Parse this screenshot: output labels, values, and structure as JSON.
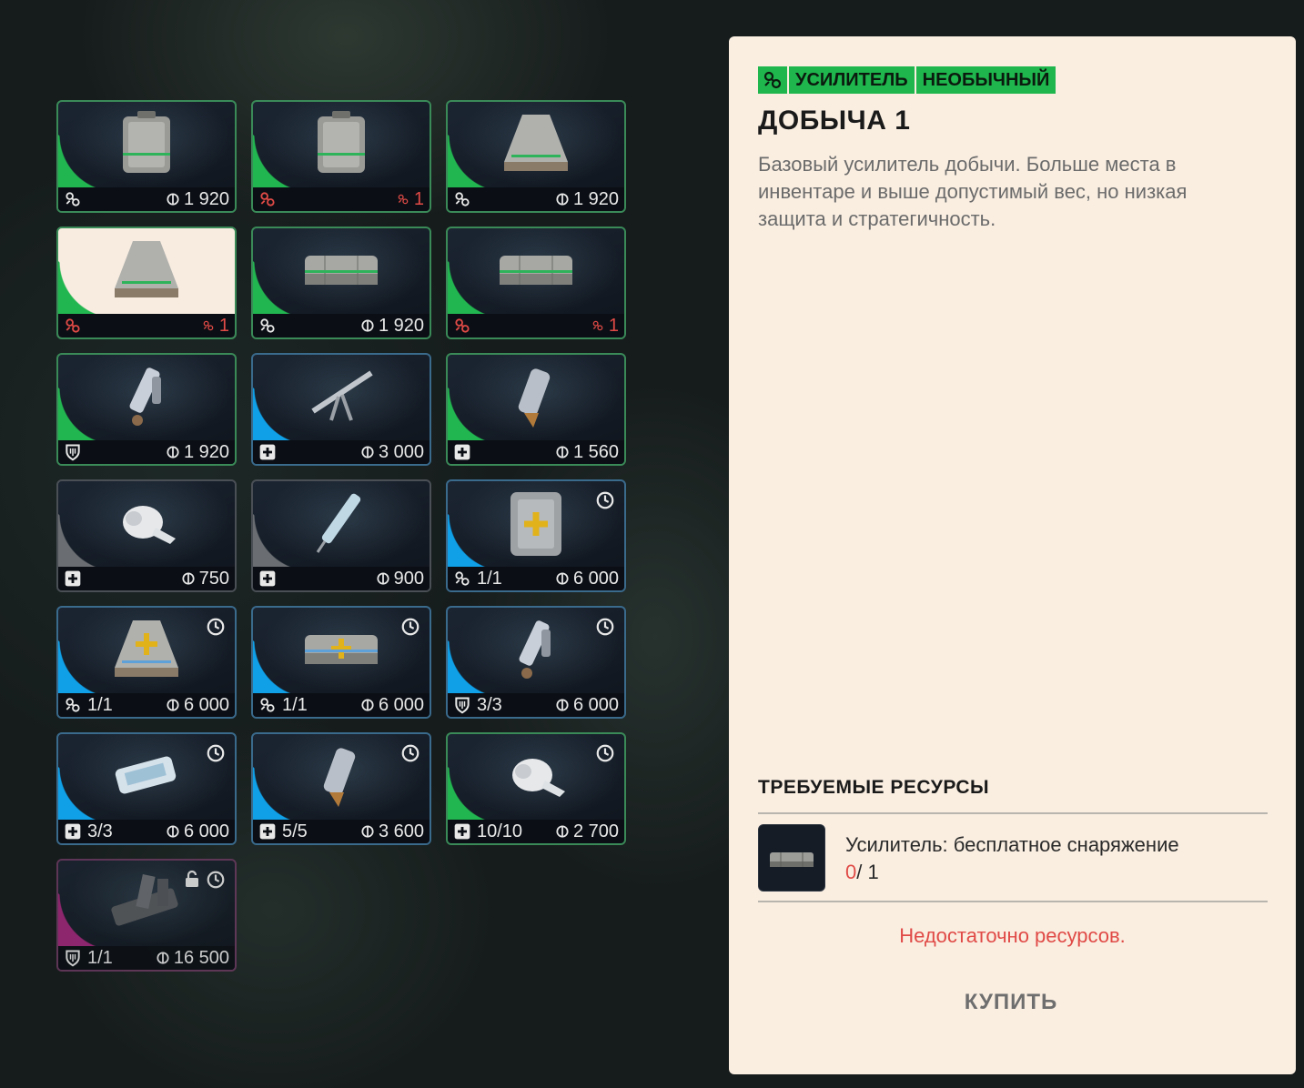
{
  "grid": {
    "items": [
      {
        "id": "c0",
        "rarity": "green",
        "thumb": "crate",
        "cat_icon": "augment-icon",
        "cat_red": false,
        "count": "",
        "price": "1 920",
        "price_red": false,
        "timer": false,
        "lock": false,
        "selected": false
      },
      {
        "id": "c1",
        "rarity": "green",
        "thumb": "crate",
        "cat_icon": "augment-icon",
        "cat_red": true,
        "count": "",
        "price": "1",
        "price_red": true,
        "timer": false,
        "lock": false,
        "selected": false
      },
      {
        "id": "c2",
        "rarity": "green",
        "thumb": "pyramid",
        "cat_icon": "augment-icon",
        "cat_red": false,
        "count": "",
        "price": "1 920",
        "price_red": false,
        "timer": false,
        "lock": false,
        "selected": false
      },
      {
        "id": "c3",
        "rarity": "green",
        "thumb": "pyramid",
        "cat_icon": "augment-icon",
        "cat_red": true,
        "count": "",
        "price": "1",
        "price_red": true,
        "timer": false,
        "lock": false,
        "selected": true
      },
      {
        "id": "c4",
        "rarity": "green",
        "thumb": "long",
        "cat_icon": "augment-icon",
        "cat_red": false,
        "count": "",
        "price": "1 920",
        "price_red": false,
        "timer": false,
        "lock": false,
        "selected": false
      },
      {
        "id": "c5",
        "rarity": "green",
        "thumb": "long",
        "cat_icon": "augment-icon",
        "cat_red": true,
        "count": "",
        "price": "1",
        "price_red": true,
        "timer": false,
        "lock": false,
        "selected": false
      },
      {
        "id": "c6",
        "rarity": "green",
        "thumb": "gadget",
        "cat_icon": "shield-icon",
        "cat_red": false,
        "count": "",
        "price": "1 920",
        "price_red": false,
        "timer": false,
        "lock": false,
        "selected": false
      },
      {
        "id": "c7",
        "rarity": "blue",
        "thumb": "tool",
        "cat_icon": "medkit-icon",
        "cat_red": false,
        "count": "",
        "price": "3 000",
        "price_red": false,
        "timer": false,
        "lock": false,
        "selected": false
      },
      {
        "id": "c8",
        "rarity": "green",
        "thumb": "vial",
        "cat_icon": "medkit-icon",
        "cat_red": false,
        "count": "",
        "price": "1 560",
        "price_red": false,
        "timer": false,
        "lock": false,
        "selected": false
      },
      {
        "id": "c9",
        "rarity": "gray",
        "thumb": "bandage",
        "cat_icon": "medkit-icon",
        "cat_red": false,
        "count": "",
        "price": "750",
        "price_red": false,
        "timer": false,
        "lock": false,
        "selected": false
      },
      {
        "id": "c10",
        "rarity": "gray",
        "thumb": "syringe",
        "cat_icon": "medkit-icon",
        "cat_red": false,
        "count": "",
        "price": "900",
        "price_red": false,
        "timer": false,
        "lock": false,
        "selected": false
      },
      {
        "id": "c11",
        "rarity": "blue",
        "thumb": "medcrate",
        "cat_icon": "augment-icon",
        "cat_red": false,
        "count": "1/1",
        "price": "6 000",
        "price_red": false,
        "timer": true,
        "lock": false,
        "selected": false
      },
      {
        "id": "c12",
        "rarity": "blue",
        "thumb": "medpyramid",
        "cat_icon": "augment-icon",
        "cat_red": false,
        "count": "1/1",
        "price": "6 000",
        "price_red": false,
        "timer": true,
        "lock": false,
        "selected": false
      },
      {
        "id": "c13",
        "rarity": "blue",
        "thumb": "medlong",
        "cat_icon": "augment-icon",
        "cat_red": false,
        "count": "1/1",
        "price": "6 000",
        "price_red": false,
        "timer": true,
        "lock": false,
        "selected": false
      },
      {
        "id": "c14",
        "rarity": "blue",
        "thumb": "gadget",
        "cat_icon": "shield-icon",
        "cat_red": false,
        "count": "3/3",
        "price": "6 000",
        "price_red": false,
        "timer": true,
        "lock": false,
        "selected": false
      },
      {
        "id": "c15",
        "rarity": "blue",
        "thumb": "pack",
        "cat_icon": "medkit-icon",
        "cat_red": false,
        "count": "3/3",
        "price": "6 000",
        "price_red": false,
        "timer": true,
        "lock": false,
        "selected": false
      },
      {
        "id": "c16",
        "rarity": "blue",
        "thumb": "vial",
        "cat_icon": "medkit-icon",
        "cat_red": false,
        "count": "5/5",
        "price": "3 600",
        "price_red": false,
        "timer": true,
        "lock": false,
        "selected": false
      },
      {
        "id": "c17",
        "rarity": "green",
        "thumb": "bandage",
        "cat_icon": "medkit-icon",
        "cat_red": false,
        "count": "10/10",
        "price": "2 700",
        "price_red": false,
        "timer": true,
        "lock": false,
        "selected": false
      },
      {
        "id": "c18",
        "rarity": "purple",
        "thumb": "heavy",
        "cat_icon": "shield-icon",
        "cat_red": false,
        "count": "1/1",
        "price": "16 500",
        "price_red": false,
        "timer": true,
        "lock": true,
        "selected": false
      }
    ]
  },
  "detail": {
    "tags": [
      "УСИЛИТЕЛЬ",
      "НЕОБЫЧНЫЙ"
    ],
    "title": "ДОБЫЧА 1",
    "description": "Базовый усилитель добычи. Больше места в инвентаре и выше допустимый вес, но низкая защита и стратегичность.",
    "requirements_header": "ТРЕБУЕМЫЕ РЕСУРСЫ",
    "requirement": {
      "name": "Усилитель: бесплатное снаряжение",
      "have": "0",
      "need": "/ 1"
    },
    "warning": "Недостаточно ресурсов.",
    "buy_label": "КУПИТЬ"
  },
  "colors": {
    "green": "#22b650",
    "blue": "#0fa0e8",
    "gray": "#6a6e72",
    "purple": "#a2287c",
    "red": "#e04a46",
    "panel": "#faeee1"
  }
}
